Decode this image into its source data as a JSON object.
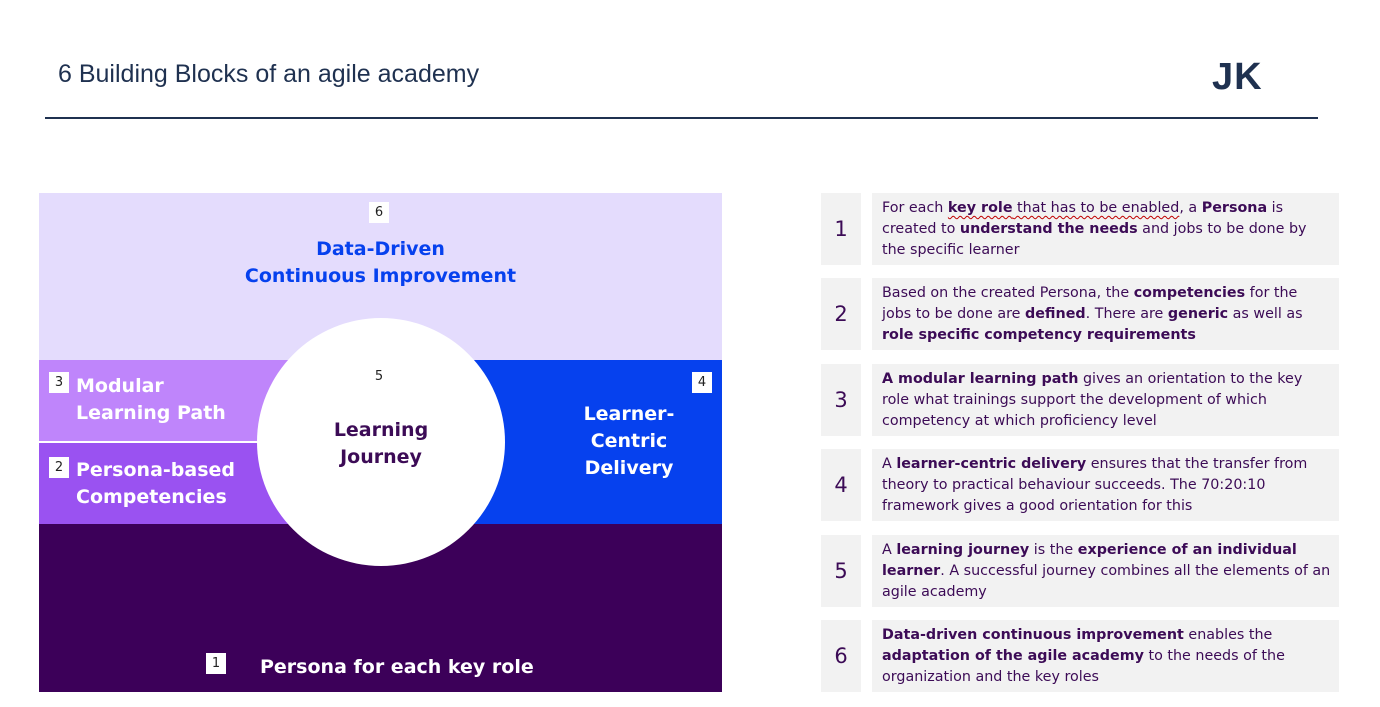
{
  "header": {
    "title": "6 Building Blocks of an agile academy",
    "logo": "JK"
  },
  "diagram": {
    "block6": {
      "number": "6",
      "line1": "Data-Driven",
      "line2": "Continuous Improvement"
    },
    "block3": {
      "number": "3",
      "line1": "Modular",
      "line2": "Learning Path"
    },
    "block2": {
      "number": "2",
      "line1": "Persona-based",
      "line2": "Competencies"
    },
    "block4": {
      "number": "4",
      "line1": "Learner-",
      "line2": "Centric",
      "line3": "Delivery"
    },
    "block5": {
      "number": "5",
      "line1": "Learning",
      "line2": "Journey"
    },
    "block1": {
      "number": "1",
      "label": "Persona for each key role"
    },
    "colors": {
      "b6": "#e4dcfd",
      "b3": "#bf85fb",
      "b2": "#9a52f1",
      "b4": "#0641ee",
      "b1": "#3c0059",
      "title_blue": "#0641ee",
      "dark_purple": "#3c0b56"
    }
  },
  "descriptions": [
    {
      "number": "1",
      "segments": [
        {
          "text": "For each ",
          "bold": false
        },
        {
          "text": "key role",
          "bold": true,
          "squiggle": true
        },
        {
          "text": " that has to be enabled",
          "bold": false,
          "squiggle": true
        },
        {
          "text": ", a ",
          "bold": false
        },
        {
          "text": "Persona",
          "bold": true
        },
        {
          "text": " is created to ",
          "bold": false
        },
        {
          "text": "understand the needs",
          "bold": true
        },
        {
          "text": " and jobs to be done by the specific learner",
          "bold": false
        }
      ]
    },
    {
      "number": "2",
      "segments": [
        {
          "text": "Based on the created Persona, the ",
          "bold": false
        },
        {
          "text": "competencies",
          "bold": true
        },
        {
          "text": " for the jobs to be done are ",
          "bold": false
        },
        {
          "text": "defined",
          "bold": true
        },
        {
          "text": ". There are ",
          "bold": false
        },
        {
          "text": "generic",
          "bold": true
        },
        {
          "text": " as well as ",
          "bold": false
        },
        {
          "text": "role specific competency requirements",
          "bold": true
        }
      ]
    },
    {
      "number": "3",
      "segments": [
        {
          "text": "A modular learning path",
          "bold": true
        },
        {
          "text": " gives an orientation to the key role what trainings support the development of which competency at which proficiency level",
          "bold": false
        }
      ]
    },
    {
      "number": "4",
      "segments": [
        {
          "text": "A ",
          "bold": false
        },
        {
          "text": "learner-centric delivery",
          "bold": true
        },
        {
          "text": " ensures that the transfer from theory to practical behaviour succeeds. The 70:20:10 framework gives a good orientation for this",
          "bold": false
        }
      ]
    },
    {
      "number": "5",
      "segments": [
        {
          "text": "A ",
          "bold": false
        },
        {
          "text": "learning journey",
          "bold": true
        },
        {
          "text": " is the ",
          "bold": false
        },
        {
          "text": "experience of an individual learner",
          "bold": true
        },
        {
          "text": ". A successful journey combines all the elements of an agile academy",
          "bold": false
        }
      ]
    },
    {
      "number": "6",
      "segments": [
        {
          "text": "Data-driven continuous improvement",
          "bold": true
        },
        {
          "text": " enables the ",
          "bold": false
        },
        {
          "text": "adaptation of the agile academy",
          "bold": true
        },
        {
          "text": " to the needs of the organization and the key roles",
          "bold": false
        }
      ]
    }
  ]
}
